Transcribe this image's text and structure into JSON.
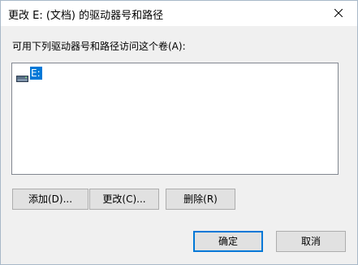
{
  "window": {
    "title": "更改 E: (文档) 的驱动器号和路径"
  },
  "dialog": {
    "prompt": "可用下列驱动器号和路径访问这个卷(A):",
    "list_items": [
      {
        "label": "E:",
        "icon": "drive-icon",
        "selected": true
      }
    ],
    "buttons": {
      "add": "添加(D)...",
      "change": "更改(C)...",
      "delete": "删除(R)",
      "ok": "确定",
      "cancel": "取消"
    }
  },
  "colors": {
    "selection": "#0078d7",
    "default_button_border": "#0078d7",
    "dialog_background": "#f0f0f0"
  }
}
